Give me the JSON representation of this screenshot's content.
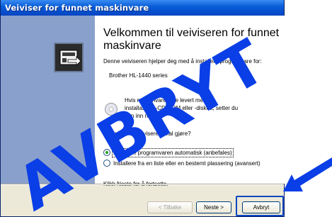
{
  "window": {
    "title": "Veiviser for funnet maskinvare"
  },
  "main": {
    "heading_line1": "Velkommen til veiviseren for funnet",
    "heading_line2": "maskinvare",
    "intro": "Denne veiviseren hjelper deg med å installere programvare for:",
    "device": "Brother HL-1440 series",
    "cd_text_line1": "Hvis maskinvaren ble levert med en",
    "cd_text_line2": "installasjons-CD-ROM eller -diskett, setter du",
    "cd_text_line3": "den inn nå.",
    "question": "Hva vil du at veiviseren skal gjøre?",
    "options": [
      {
        "label": "Installere programvaren automatisk (anbefales)",
        "selected": true
      },
      {
        "label": "Installere fra en liste eller en bestemt plassering (avansert)",
        "selected": false
      }
    ],
    "footer_text": "Klikk Neste for å fortsette."
  },
  "buttons": {
    "back": "< Tilbake",
    "next": "Neste >",
    "cancel": "Avbryt"
  },
  "overlay": {
    "stamp_text": "AVBRYT",
    "color": "#0a3ee6"
  }
}
